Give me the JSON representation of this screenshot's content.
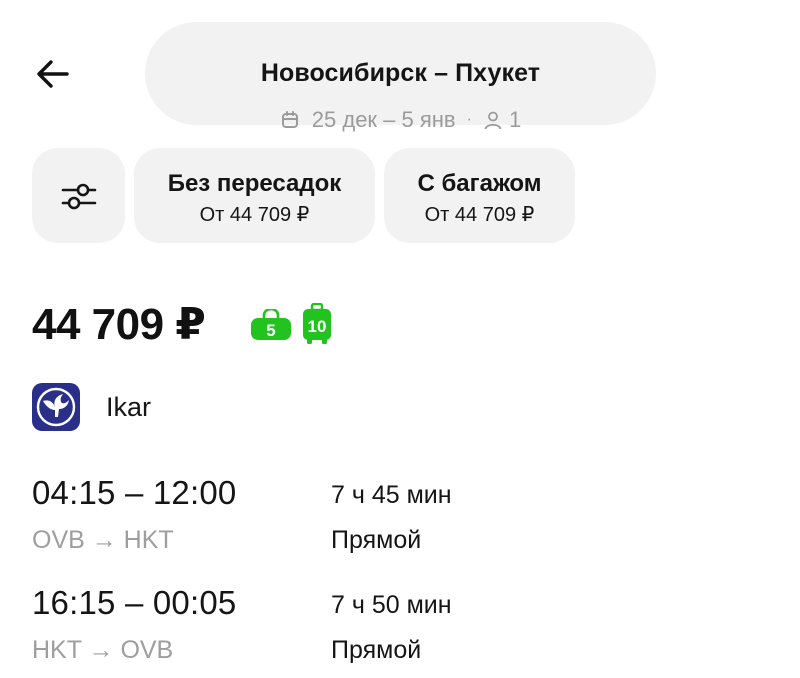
{
  "header": {
    "route_title": "Новосибирск – Пхукет",
    "dates": "25 дек – 5 янв",
    "separator": "·",
    "passengers": "1"
  },
  "filters": [
    {
      "title": "Без пересадок",
      "subtitle": "От 44 709 ₽"
    },
    {
      "title": "С багажом",
      "subtitle": "От 44 709 ₽"
    }
  ],
  "offer": {
    "price": "44 709 ₽",
    "hand_baggage_kg": "5",
    "checked_baggage_kg": "10",
    "baggage_color": "#22c21f",
    "airline": "Ikar",
    "airline_logo_color": "#2a2f8a",
    "flights": [
      {
        "times": "04:15 – 12:00",
        "route": "OVB → HKT",
        "duration": "7 ч 45 мин",
        "stops": "Прямой"
      },
      {
        "times": "16:15 – 00:05",
        "route": "HKT → OVB",
        "duration": "7 ч 50 мин",
        "stops": "Прямой"
      }
    ]
  }
}
